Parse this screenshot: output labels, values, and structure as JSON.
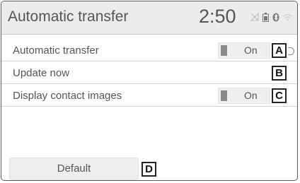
{
  "header": {
    "title": "Automatic transfer",
    "clock": "2:50",
    "status_icons": [
      "signal-icon",
      "battery-icon",
      "bluetooth-icon",
      "wifi-icon"
    ]
  },
  "rows": [
    {
      "label": "Automatic transfer",
      "toggle": "On",
      "callout": "A"
    },
    {
      "label": "Update now",
      "callout": "B"
    },
    {
      "label": "Display contact images",
      "toggle": "On",
      "callout": "C"
    }
  ],
  "footer": {
    "default_label": "Default",
    "callout": "D"
  },
  "colors": {
    "text": "#555555",
    "header_bg": "#ececec",
    "toggle_indicator": "#8a8a8a",
    "button_bg": "#eeeeee"
  }
}
